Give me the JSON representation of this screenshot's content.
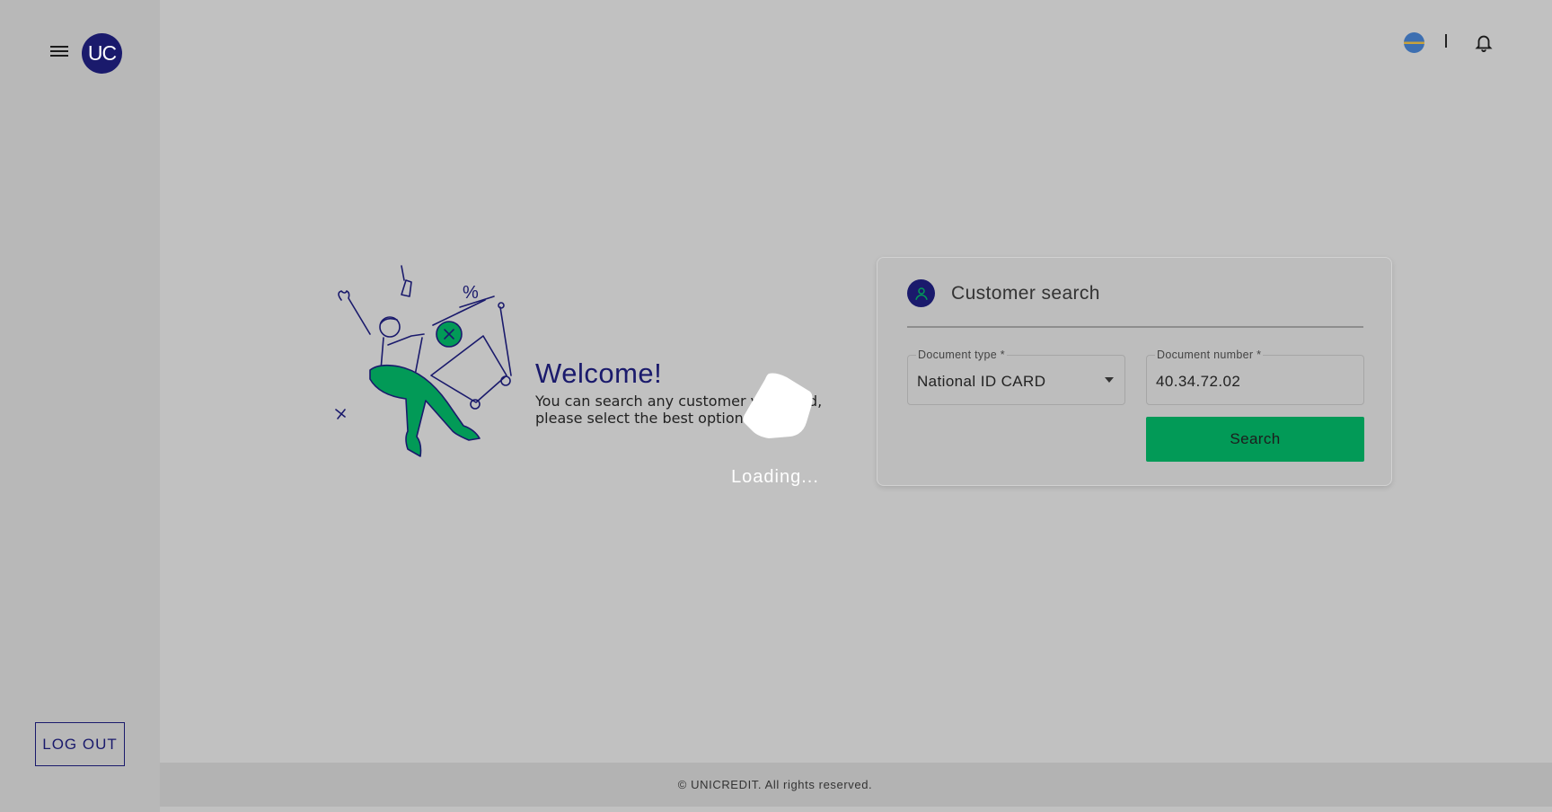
{
  "brand": {
    "logo_text": "UC",
    "accent": "#1a1a6c",
    "primary_button": "#029a57"
  },
  "sidebar": {
    "logout_label": "LOG OUT",
    "menu_icon": "hamburger-icon"
  },
  "topbar": {
    "language_icon": "flag-icon",
    "notifications_icon": "bell-icon"
  },
  "welcome": {
    "title": "Welcome!",
    "line1": "You can search any customer you need,",
    "line2": "please select the best option for you."
  },
  "customer_search": {
    "title": "Customer search",
    "document_type": {
      "label": "Document type *",
      "value": "National ID CARD"
    },
    "document_number": {
      "label": "Document number *",
      "value": "40.34.72.02"
    },
    "search_label": "Search"
  },
  "overlay": {
    "loading_text": "Loading..."
  },
  "footer": {
    "copyright": "© UNICREDIT. All rights reserved."
  }
}
